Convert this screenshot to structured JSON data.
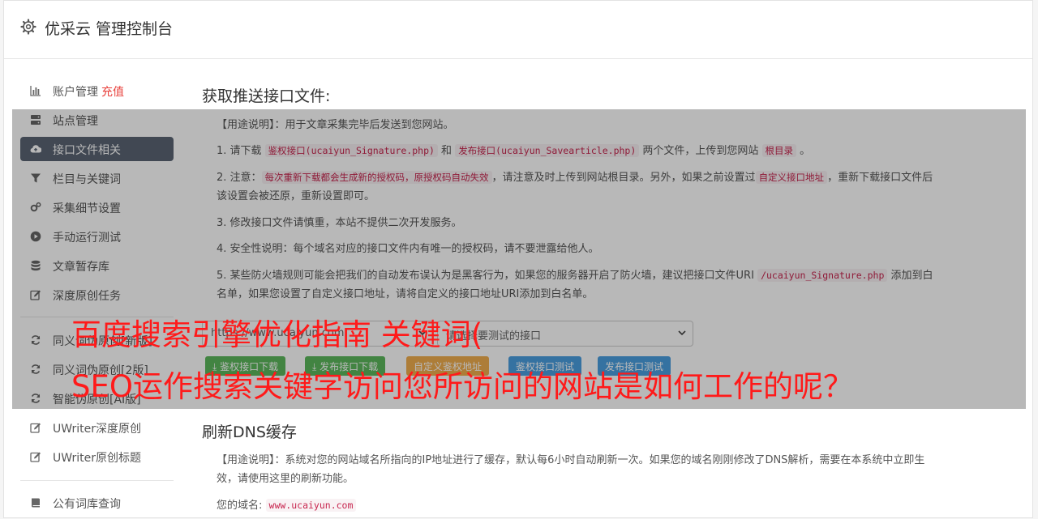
{
  "header": {
    "title": "优采云 管理控制台"
  },
  "sidebar": {
    "items": [
      {
        "label": "账户管理",
        "extra": "充值",
        "icon": "bar-chart-icon"
      },
      {
        "label": "站点管理",
        "icon": "server-icon"
      },
      {
        "label": "接口文件相关",
        "icon": "cloud-upload-icon",
        "active": true
      },
      {
        "label": "栏目与关键词",
        "icon": "filter-icon"
      },
      {
        "label": "采集细节设置",
        "icon": "gears-icon"
      },
      {
        "label": "手动运行测试",
        "icon": "play-circle-icon"
      },
      {
        "label": "文章暂存库",
        "icon": "database-icon"
      },
      {
        "label": "深度原创任务",
        "icon": "edit-icon"
      },
      {
        "label": "同义词伪原创[新版]",
        "icon": "refresh-icon"
      },
      {
        "label": "同义词伪原创[2版]",
        "icon": "refresh-icon"
      },
      {
        "label": "智能伪原创[AI版]",
        "icon": "refresh-icon"
      },
      {
        "label": "UWriter深度原创",
        "icon": "edit-icon"
      },
      {
        "label": "UWriter原创标题",
        "icon": "edit-icon"
      },
      {
        "label": "公有词库查询",
        "icon": "book-icon"
      }
    ]
  },
  "section1": {
    "title": "获取推送接口文件:",
    "usage": "【用途说明】：用于文章采集完毕后发送到您网站。",
    "step1": {
      "prefix": "1. 请下载 ",
      "code1": "鉴权接口(ucaiyun_Signature.php)",
      "mid": " 和 ",
      "code2": "发布接口(ucaiyun_Savearticle.php)",
      "mid2": " 两个文件，上传到您网站 ",
      "code3": "根目录",
      "suffix": " 。"
    },
    "step2": {
      "prefix": "2. 注意：",
      "code1": "每次重新下载都会生成新的授权码，原授权码自动失效",
      "mid": "，请注意及时上传到网站根目录。另外，如果之前设置过",
      "code2": "自定义接口地址",
      "suffix": "，重新下载接口文件后该设置会被还原，重新设置即可。"
    },
    "step3": "3. 修改接口文件请慎重，本站不提供二次开发服务。",
    "step4": "4. 安全性说明：每个域名对应的接口文件内有唯一的授权码，请不要泄露给他人。",
    "step5": {
      "prefix": "5. 某些防火墙规则可能会把我们的自动发布误认为是黑客行为，如果您的服务器开启了防火墙，建议把接口文件URI ",
      "code1": "/ucaiyun_Signature.php",
      "suffix": " 添加到白名单，如果您设置了自定义接口地址，请将自定义的接口地址URI添加到白名单。"
    },
    "site_select": "https://www.ucaiyun.com",
    "type_select": "请选择要测试的接口",
    "buttons": {
      "download_auth": "鉴权接口下载",
      "download_publish": "发布接口下载",
      "custom_auth": "自定义鉴权地址",
      "test_auth": "鉴权接口测试",
      "test_publish": "发布接口测试"
    }
  },
  "section2": {
    "title": "刷新DNS缓存",
    "usage": "【用途说明】：系统对您的网站域名所指向的IP地址进行了缓存，默认每6小时自动刷新一次。如果您的域名刚刚修改了DNS解析，需要在本系统中立即生效，请使用这里的刷新功能。",
    "domain_label": "您的域名:",
    "domain_value": "www.ucaiyun.com"
  },
  "overlay": {
    "line1": "百度搜索引擎优化指南 关键词(",
    "line2": "SEO运作搜索关键字访问您所访问的网站是如何工作的呢？"
  },
  "colors": {
    "accent_red": "#ff1a1a",
    "active_nav": "#5b6574",
    "code_red": "#c7254e"
  }
}
